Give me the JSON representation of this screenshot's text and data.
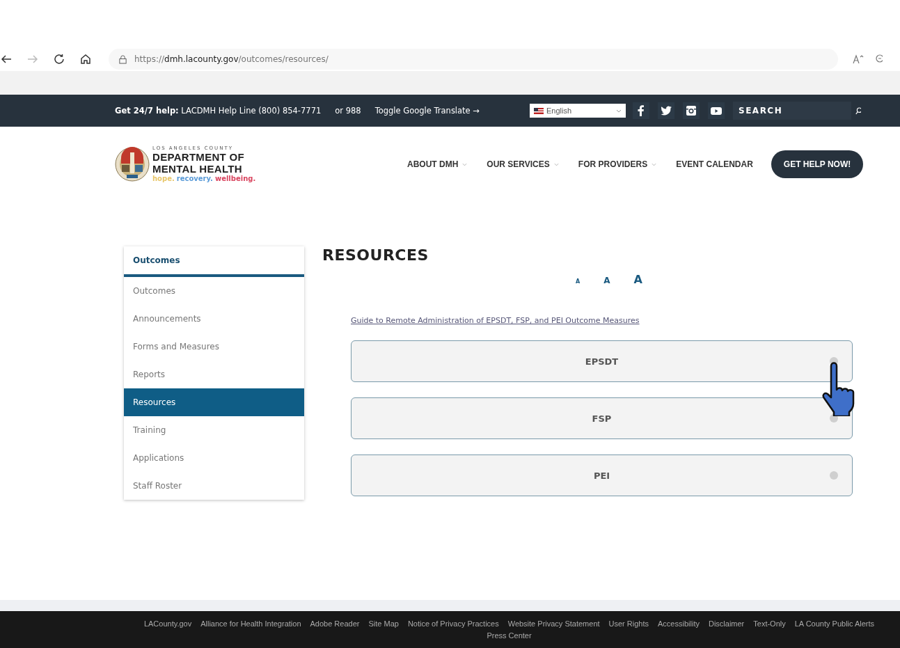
{
  "browser": {
    "url": "https://**dmh.lacounty.gov**/outcomes/resources/"
  },
  "topbar": {
    "help": "**Get 24/7 help:** LACDMH Help Line (800) 854-7771",
    "alt": "or 988",
    "translate": "Toggle Google Translate →",
    "language": "English",
    "search": {
      "placeholder": "SEARCH"
    }
  },
  "logo": {
    "county": "LOS ANGELES COUNTY",
    "line1": "DEPARTMENT OF",
    "line2": "MENTAL HEALTH",
    "tagline": [
      {
        "text": "hope.",
        "color": "#e8c66a"
      },
      {
        "text": "recovery.",
        "color": "#5a9bd8"
      },
      {
        "text": "wellbeing.",
        "color": "#d9455f"
      }
    ]
  },
  "nav": [
    {
      "label": "ABOUT DMH",
      "has_menu": true
    },
    {
      "label": "OUR SERVICES",
      "has_menu": true
    },
    {
      "label": "FOR PROVIDERS",
      "has_menu": true
    },
    {
      "label": "EVENT CALENDAR",
      "has_menu": false
    }
  ],
  "cta": "GET HELP NOW!",
  "sidebar": {
    "title": "Outcomes",
    "items": [
      {
        "label": "Outcomes",
        "selected": false
      },
      {
        "label": "Announcements",
        "selected": false
      },
      {
        "label": "Forms and Measures",
        "selected": false
      },
      {
        "label": "Reports",
        "selected": false
      },
      {
        "label": "Resources",
        "selected": true
      },
      {
        "label": "Training",
        "selected": false
      },
      {
        "label": "Applications",
        "selected": false
      },
      {
        "label": "Staff Roster",
        "selected": false
      }
    ]
  },
  "content": {
    "title": "RESOURCES",
    "font_sizes": [
      {
        "label": "A",
        "kind": "small"
      },
      {
        "label": "A",
        "kind": "medium"
      },
      {
        "label": "A",
        "kind": "large"
      }
    ],
    "link": "Guide to Remote Administration of EPSDT, FSP, and PEI Outcome Measures",
    "accordions": [
      {
        "label": "EPSDT",
        "expanded": false
      },
      {
        "label": "FSP",
        "expanded": false
      },
      {
        "label": "PEI",
        "expanded": false
      }
    ]
  },
  "footer": [
    "LACounty.gov",
    "Alliance for Health Integration",
    "Adobe Reader",
    "Site Map",
    "Notice of Privacy Practices",
    "Website Privacy Statement",
    "User Rights",
    "Accessibility",
    "Disclaimer",
    "Text-Only",
    "LA County Public Alerts",
    "Press Center"
  ]
}
